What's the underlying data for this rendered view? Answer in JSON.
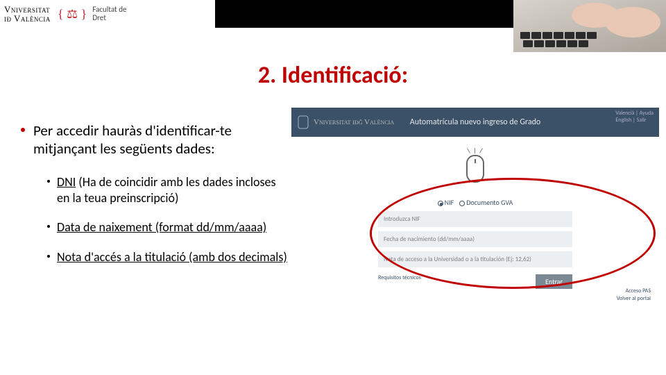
{
  "header": {
    "uni_line1": "Vniversitat",
    "uni_line2": "ið València",
    "faculty_line1": "Facultat de",
    "faculty_line2": "Dret",
    "faculty_symbol": "{ ⚖ }"
  },
  "title": "2. Identificació:",
  "bullets": {
    "intro": "Per accedir hauràs d'identificar-te mitjançant les següents dades:",
    "items": [
      {
        "u": "DNI",
        "rest": " (Ha de coincidir amb les dades incloses en la teua preinscripció)"
      },
      {
        "u": "Data de naixement (format dd/mm/aaaa)",
        "rest": ""
      },
      {
        "u": "Nota d'accés a la titulació (amb dos decimals)",
        "rest": ""
      }
    ]
  },
  "screenshot": {
    "brand": "Vniversitat iðğ València",
    "app_title": "Automatrícula nuevo ingreso de Grado",
    "lang_row1_a": "Valencià",
    "lang_row1_b": "Ayuda",
    "lang_row2_a": "English",
    "lang_row2_b": "Salir",
    "radio_nif": "NIF",
    "radio_gva": "Documento GVA",
    "fields": {
      "nif": "Introduzca NIF",
      "dob": "Fecha de nacimiento (dd/mm/aaaa)",
      "nota": "Nota de acceso a la Universidad o a la titulación (Ej: 12,62)"
    },
    "req_link": "Requisitos técnicos",
    "enter_btn": "Entrar",
    "footer_link1": "Acceso PAS",
    "footer_link2": "Volver al portal"
  }
}
